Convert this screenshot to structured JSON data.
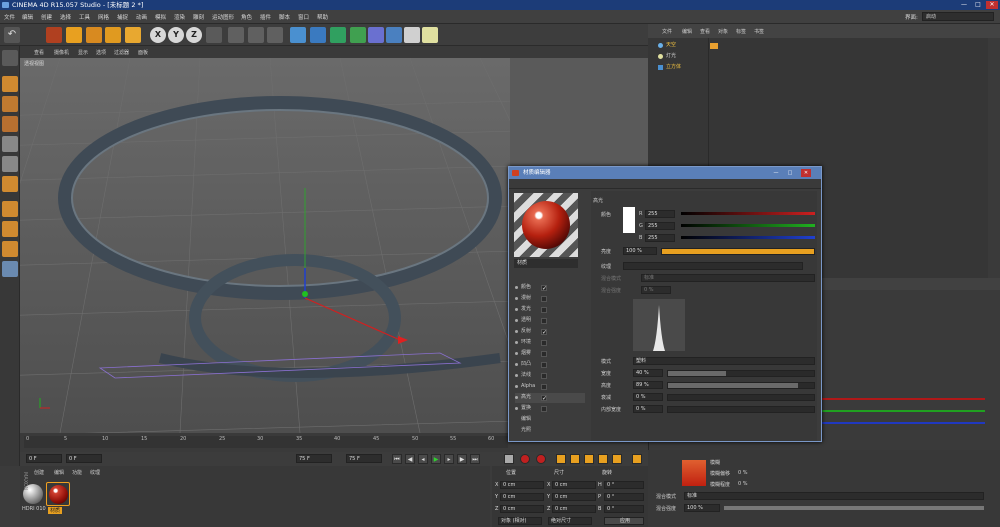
{
  "window": {
    "title": "CINEMA 4D R15.057 Studio - [未标题 2 *]",
    "min": "—",
    "max": "□",
    "close": "✕"
  },
  "menu": [
    "文件",
    "编辑",
    "创建",
    "选择",
    "工具",
    "网格",
    "捕捉",
    "动画",
    "模拟",
    "渲染",
    "雕刻",
    "运动图形",
    "角色",
    "插件",
    "脚本",
    "窗口",
    "帮助"
  ],
  "layout": {
    "label": "界面:",
    "value": "启动"
  },
  "toolbar": {
    "x": "X",
    "y": "Y",
    "z": "Z"
  },
  "viewport": {
    "menu": [
      "查看",
      "摄像机",
      "显示",
      "选项",
      "过滤器",
      "面板"
    ],
    "label": "透视视图"
  },
  "objects": {
    "tabs": [
      "文件",
      "编辑",
      "查看",
      "对象",
      "标签",
      "书签"
    ],
    "rows": [
      "天空",
      "灯光",
      "立方体"
    ]
  },
  "timeline": {
    "ticks": [
      "0",
      "5",
      "10",
      "15",
      "20",
      "25",
      "30",
      "35",
      "40",
      "45",
      "50",
      "55",
      "60",
      "65",
      "70",
      "75",
      "80",
      "85",
      "90"
    ],
    "start": "0 F",
    "cur": "0 F",
    "end": "75 F",
    "end2": "75 F"
  },
  "materials": {
    "tabs": [
      "创建",
      "编辑",
      "功能",
      "纹理"
    ],
    "items": [
      "HDRI 010",
      "材质"
    ]
  },
  "coords": {
    "h1": "位置",
    "h2": "尺寸",
    "h3": "旋转",
    "rows": [
      [
        "X",
        "0 cm",
        "X",
        "0 cm",
        "H",
        "0 °"
      ],
      [
        "Y",
        "0 cm",
        "Y",
        "0 cm",
        "P",
        "0 °"
      ],
      [
        "Z",
        "0 cm",
        "Z",
        "0 cm",
        "B",
        "0 °"
      ]
    ],
    "mode": "对象 (相对)",
    "size": "绝对尺寸",
    "apply": "应用"
  },
  "lowerattr": {
    "l1": "模糊",
    "l2": "模糊偏移",
    "l3": "模糊程度",
    "v1": "0 %",
    "v2": "0 %",
    "mix": "混合模式",
    "mixv": "标准",
    "mixs": "混合强度",
    "mixsv": "100 %"
  },
  "dialog": {
    "title": "材质编辑器",
    "matname": "材质",
    "channels": [
      [
        "颜色",
        true
      ],
      [
        "漫射",
        false
      ],
      [
        "发光",
        false
      ],
      [
        "透明",
        false
      ],
      [
        "反射",
        true
      ],
      [
        "环境",
        false
      ],
      [
        "烟雾",
        false
      ],
      [
        "凹凸",
        false
      ],
      [
        "法线",
        false
      ],
      [
        "Alpha",
        false
      ],
      [
        "高光",
        true
      ],
      [
        "置换",
        false
      ],
      [
        "编辑",
        null
      ],
      [
        "光照",
        null
      ]
    ],
    "section": "高光",
    "color_label": "颜色",
    "r": "255",
    "g": "255",
    "b": "255",
    "R": "R",
    "G": "G",
    "B": "B",
    "bright_label": "亮度",
    "bright": "100 %",
    "tex_label": "纹理",
    "mix_label": "混合模式",
    "mix_val": "标准",
    "mixs_label": "混合强度",
    "mixs_val": "0 %",
    "mode_label": "模式",
    "mode_val": "塑料",
    "width_label": "宽度",
    "width": "40 %",
    "height_label": "高度",
    "height": "89 %",
    "falloff_label": "衰减",
    "falloff": "0 %",
    "inner_label": "内部宽度",
    "inner": "0 %",
    "width_frac": 0.4,
    "height_frac": 0.89,
    "bright_frac": 1.0
  },
  "colors": {
    "red": "#cc2020",
    "green": "#20b020",
    "blue": "#2040d0",
    "title": "#1c3c78",
    "accent": "#f0a020"
  }
}
